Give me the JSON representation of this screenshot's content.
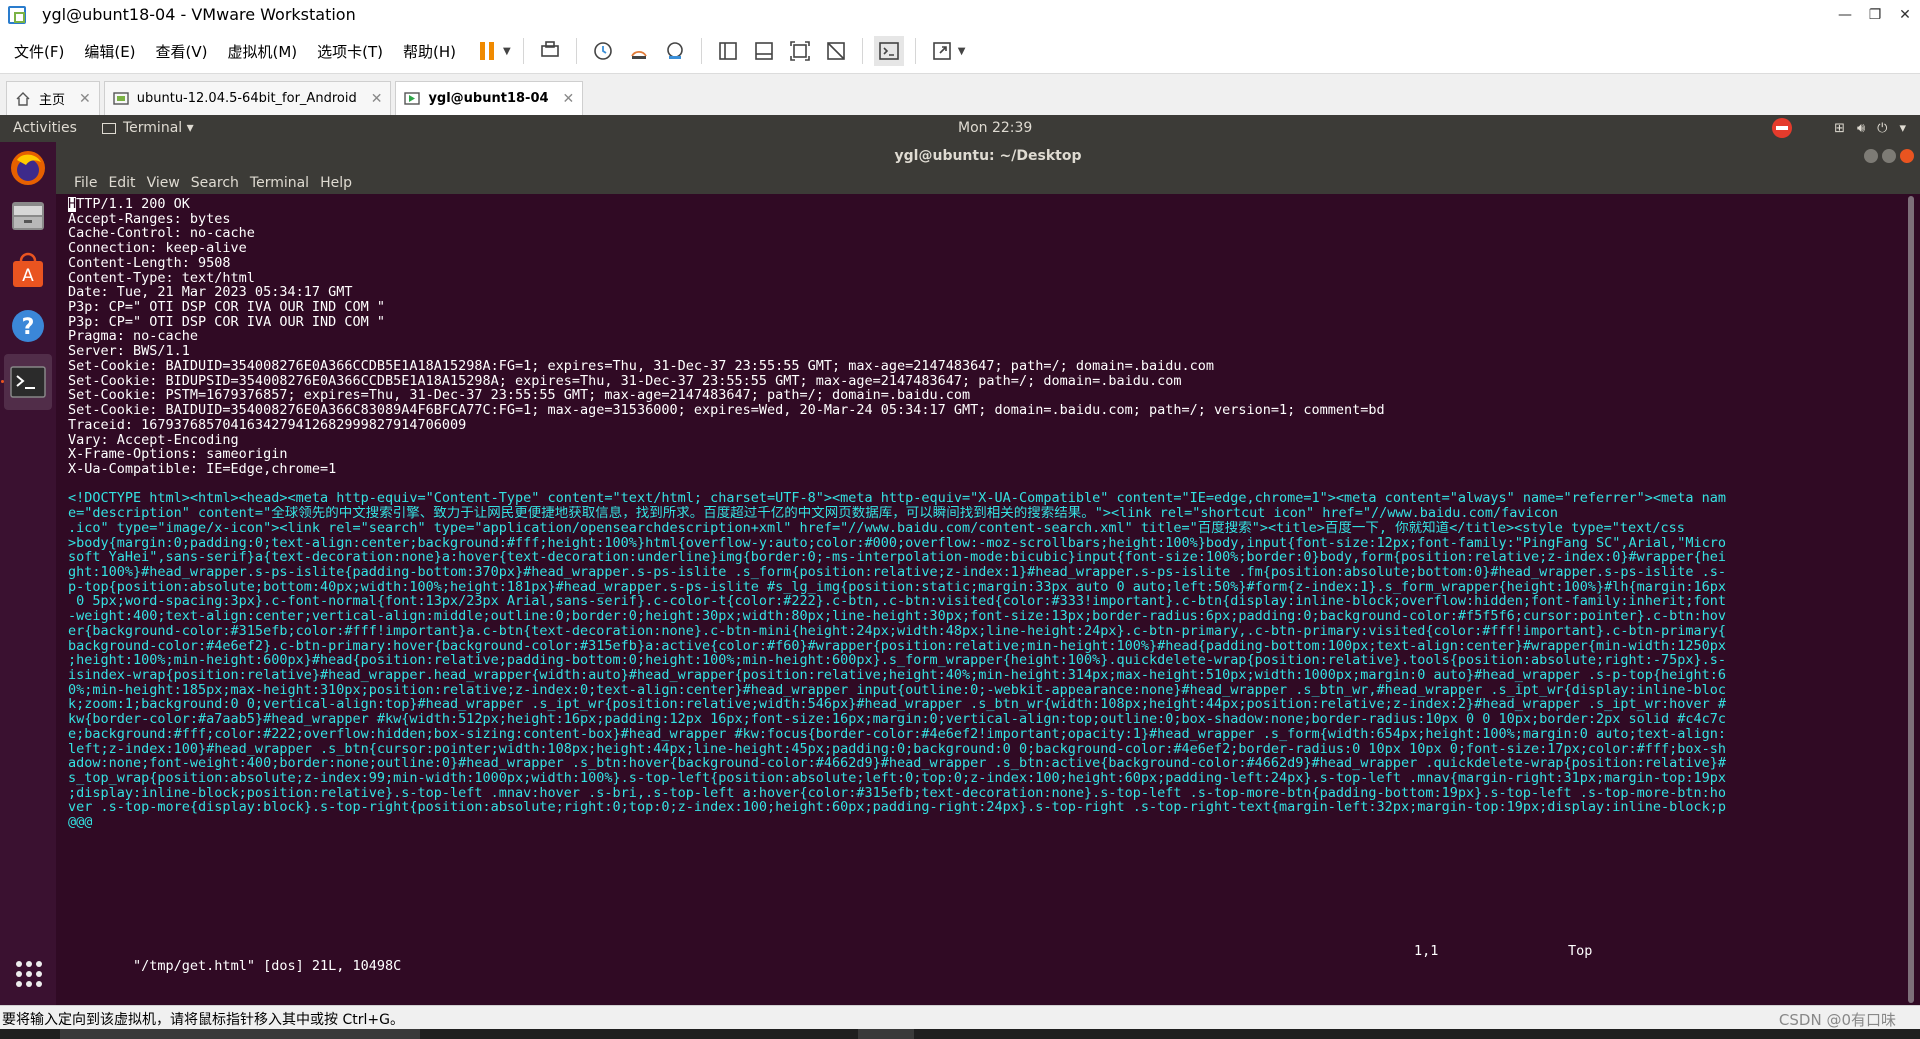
{
  "window": {
    "title": "ygl@ubunt18-04 - VMware Workstation"
  },
  "vm_menu": [
    "文件(F)",
    "编辑(E)",
    "查看(V)",
    "虚拟机(M)",
    "选项卡(T)",
    "帮助(H)"
  ],
  "tabs": [
    {
      "label": "主页",
      "icon": "home-icon",
      "active": false
    },
    {
      "label": "ubuntu-12.04.5-64bit_for_Android",
      "icon": "vm-icon",
      "active": false
    },
    {
      "label": "ygl@ubunt18-04",
      "icon": "vm-running-icon",
      "active": true
    }
  ],
  "gnome": {
    "activities": "Activities",
    "app_menu": "Terminal ▾",
    "clock": "Mon 22:39"
  },
  "terminal": {
    "title": "ygl@ubuntu: ~/Desktop",
    "menu": [
      "File",
      "Edit",
      "View",
      "Search",
      "Terminal",
      "Help"
    ],
    "headers": [
      "HTTP/1.1 200 OK",
      "Accept-Ranges: bytes",
      "Cache-Control: no-cache",
      "Connection: keep-alive",
      "Content-Length: 9508",
      "Content-Type: text/html",
      "Date: Tue, 21 Mar 2023 05:34:17 GMT",
      "P3p: CP=\" OTI DSP COR IVA OUR IND COM \"",
      "P3p: CP=\" OTI DSP COR IVA OUR IND COM \"",
      "Pragma: no-cache",
      "Server: BWS/1.1",
      "Set-Cookie: BAIDUID=354008276E0A366CCDB5E1A18A15298A:FG=1; expires=Thu, 31-Dec-37 23:55:55 GMT; max-age=2147483647; path=/; domain=.baidu.com",
      "Set-Cookie: BIDUPSID=354008276E0A366CCDB5E1A18A15298A; expires=Thu, 31-Dec-37 23:55:55 GMT; max-age=2147483647; path=/; domain=.baidu.com",
      "Set-Cookie: PSTM=1679376857; expires=Thu, 31-Dec-37 23:55:55 GMT; max-age=2147483647; path=/; domain=.baidu.com",
      "Set-Cookie: BAIDUID=354008276E0A366C83089A4F6BFCA77C:FG=1; max-age=31536000; expires=Wed, 20-Mar-24 05:34:17 GMT; domain=.baidu.com; path=/; version=1; comment=bd",
      "Traceid: 1679376857041634279412682999827914706009",
      "Vary: Accept-Encoding",
      "X-Frame-Options: sameorigin",
      "X-Ua-Compatible: IE=Edge,chrome=1",
      ""
    ],
    "html_lines": [
      "<!DOCTYPE html><html><head><meta http-equiv=\"Content-Type\" content=\"text/html; charset=UTF-8\"><meta http-equiv=\"X-UA-Compatible\" content=\"IE=edge,chrome=1\"><meta content=\"always\" name=\"referrer\"><meta nam",
      "e=\"description\" content=\"全球领先的中文搜索引擎、致力于让网民更便捷地获取信息，找到所求。百度超过千亿的中文网页数据库，可以瞬间找到相关的搜索结果。\"><link rel=\"shortcut icon\" href=\"//www.baidu.com/favicon",
      ".ico\" type=\"image/x-icon\"><link rel=\"search\" type=\"application/opensearchdescription+xml\" href=\"//www.baidu.com/content-search.xml\" title=\"百度搜索\"><title>百度一下, 你就知道</title><style type=\"text/css",
      ">body{margin:0;padding:0;text-align:center;background:#fff;height:100%}html{overflow-y:auto;color:#000;overflow:-moz-scrollbars;height:100%}body,input{font-size:12px;font-family:\"PingFang SC\",Arial,\"Micro",
      "soft YaHei\",sans-serif}a{text-decoration:none}a:hover{text-decoration:underline}img{border:0;-ms-interpolation-mode:bicubic}input{font-size:100%;border:0}body,form{position:relative;z-index:0}#wrapper{hei",
      "ght:100%}#head_wrapper.s-ps-islite{padding-bottom:370px}#head_wrapper.s-ps-islite .s_form{position:relative;z-index:1}#head_wrapper.s-ps-islite .fm{position:absolute;bottom:0}#head_wrapper.s-ps-islite .s-",
      "p-top{position:absolute;bottom:40px;width:100%;height:181px}#head_wrapper.s-ps-islite #s_lg_img{position:static;margin:33px auto 0 auto;left:50%}#form{z-index:1}.s_form_wrapper{height:100%}#lh{margin:16px",
      " 0 5px;word-spacing:3px}.c-font-normal{font:13px/23px Arial,sans-serif}.c-color-t{color:#222}.c-btn,.c-btn:visited{color:#333!important}.c-btn{display:inline-block;overflow:hidden;font-family:inherit;font",
      "-weight:400;text-align:center;vertical-align:middle;outline:0;border:0;height:30px;width:80px;line-height:30px;font-size:13px;border-radius:6px;padding:0;background-color:#f5f5f6;cursor:pointer}.c-btn:hov",
      "er{background-color:#315efb;color:#fff!important}a.c-btn{text-decoration:none}.c-btn-mini{height:24px;width:48px;line-height:24px}.c-btn-primary,.c-btn-primary:visited{color:#fff!important}.c-btn-primary{",
      "background-color:#4e6ef2}.c-btn-primary:hover{background-color:#315efb}a:active{color:#f60}#wrapper{position:relative;min-height:100%}#head{padding-bottom:100px;text-align:center}#wrapper{min-width:1250px",
      ";height:100%;min-height:600px}#head{position:relative;padding-bottom:0;height:100%;min-height:600px}.s_form_wrapper{height:100%}.quickdelete-wrap{position:relative}.tools{position:absolute;right:-75px}.s-",
      "isindex-wrap{position:relative}#head_wrapper.head_wrapper{width:auto}#head_wrapper{position:relative;height:40%;min-height:314px;max-height:510px;width:1000px;margin:0 auto}#head_wrapper .s-p-top{height:6",
      "0%;min-height:185px;max-height:310px;position:relative;z-index:0;text-align:center}#head_wrapper input{outline:0;-webkit-appearance:none}#head_wrapper .s_btn_wr,#head_wrapper .s_ipt_wr{display:inline-bloc",
      "k;zoom:1;background:0 0;vertical-align:top}#head_wrapper .s_ipt_wr{position:relative;width:546px}#head_wrapper .s_btn_wr{width:108px;height:44px;position:relative;z-index:2}#head_wrapper .s_ipt_wr:hover #",
      "kw{border-color:#a7aab5}#head_wrapper #kw{width:512px;height:16px;padding:12px 16px;font-size:16px;margin:0;vertical-align:top;outline:0;box-shadow:none;border-radius:10px 0 0 10px;border:2px solid #c4c7c",
      "e;background:#fff;color:#222;overflow:hidden;box-sizing:content-box}#head_wrapper #kw:focus{border-color:#4e6ef2!important;opacity:1}#head_wrapper .s_form{width:654px;height:100%;margin:0 auto;text-align:",
      "left;z-index:100}#head_wrapper .s_btn{cursor:pointer;width:108px;height:44px;line-height:45px;padding:0;background:0 0;background-color:#4e6ef2;border-radius:0 10px 10px 0;font-size:17px;color:#fff;box-sh",
      "adow:none;font-weight:400;border:none;outline:0}#head_wrapper .s_btn:hover{background-color:#4662d9}#head_wrapper .s_btn:active{background-color:#4662d9}#head_wrapper .quickdelete-wrap{position:relative}#",
      "s_top_wrap{position:absolute;z-index:99;min-width:1000px;width:100%}.s-top-left{position:absolute;left:0;top:0;z-index:100;height:60px;padding-left:24px}.s-top-left .mnav{margin-right:31px;margin-top:19px",
      ";display:inline-block;position:relative}.s-top-left .mnav:hover .s-bri,.s-top-left a:hover{color:#315efb;text-decoration:none}.s-top-left .s-top-more-btn{padding-bottom:19px}.s-top-left .s-top-more-btn:ho",
      "ver .s-top-more{display:block}.s-top-right{position:absolute;right:0;top:0;z-index:100;height:60px;padding-right:24px}.s-top-right .s-top-right-text{margin-left:32px;margin-top:19px;display:inline-block;p",
      "@@@"
    ],
    "status_file": "\"/tmp/get.html\" [dos] 21L, 10498C",
    "status_pos": "1,1",
    "status_scroll": "Top"
  },
  "vm_status": {
    "message": "要将输入定向到该虚拟机，请将鼠标指针移入其中或按 Ctrl+G。",
    "watermark": "CSDN @0有口味"
  },
  "colors": {
    "terminal_bg": "#300a24",
    "html_text": "#34e2e2",
    "ubuntu_orange": "#e95420",
    "gnome_panel": "#3c3b37"
  }
}
